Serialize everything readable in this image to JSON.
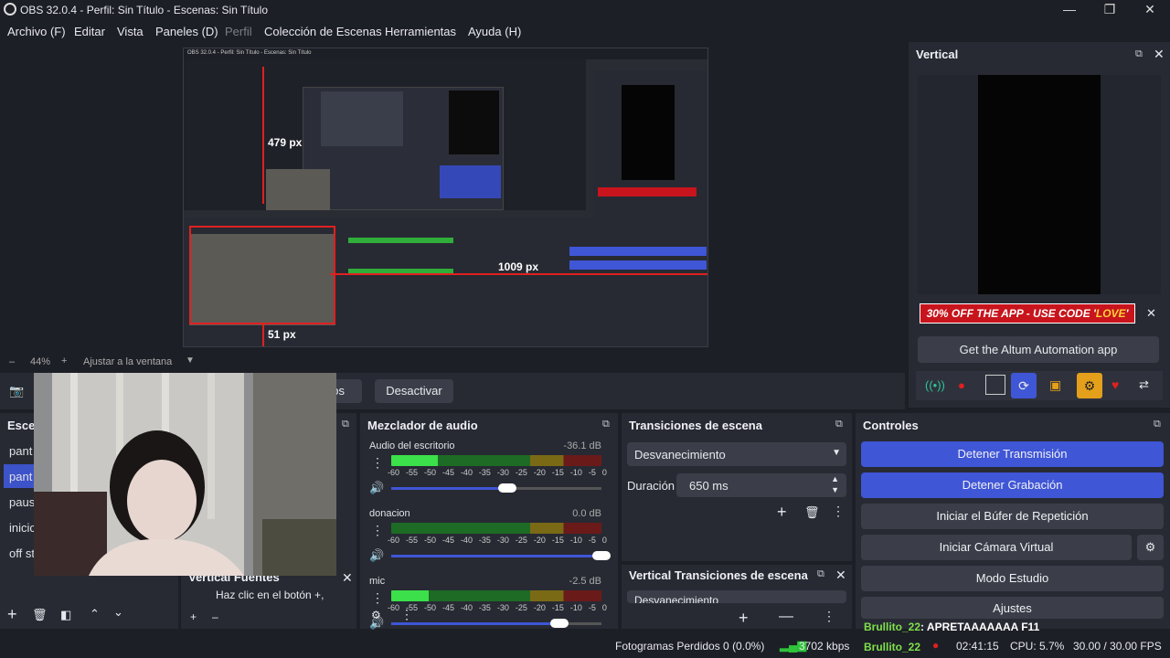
{
  "window": {
    "title": "OBS 32.0.4 - Perfil: Sin Título - Escenas: Sin Título",
    "minimize": "—",
    "maximize": "❐",
    "close": "✕"
  },
  "menu": [
    "Archivo (F)",
    "Editar",
    "Vista",
    "Paneles (D)",
    "Perfil",
    "Colección de Escenas",
    "Herramientas",
    "Ayuda (H)"
  ],
  "preview": {
    "nested_title": "OBS 32.0.4 - Perfil: Sin Título - Escenas: Sin Título",
    "measure_top": "479 px",
    "measure_right": "1009 px",
    "measure_bottom": "51 px"
  },
  "zoom": {
    "minus": "–",
    "value": "44%",
    "plus": "+",
    "fit_label": "Ajustar a la ventana"
  },
  "source_toolbar": {
    "filters_partial": "ros",
    "deactivate_label": "Desactivar"
  },
  "scenes": {
    "title_partial": "Escen",
    "items": [
      {
        "label": "pant",
        "selected": false
      },
      {
        "label": "pant",
        "selected": true
      },
      {
        "label": "paus",
        "selected": false
      },
      {
        "label": "inicic",
        "selected": false
      },
      {
        "label": "off st",
        "selected": false
      }
    ]
  },
  "vertical_sources": {
    "title": "Vertical Fuentes",
    "hint": "Haz clic en el botón +,"
  },
  "audio_mixer": {
    "title": "Mezclador de audio",
    "scale": [
      "-60",
      "-55",
      "-50",
      "-45",
      "-40",
      "-35",
      "-30",
      "-25",
      "-20",
      "-15",
      "-10",
      "-5",
      "0"
    ],
    "channels": [
      {
        "name": "Audio del escritorio",
        "db": "-36.1 dB",
        "level": 0.22,
        "volume": 0.55
      },
      {
        "name": "donacion",
        "db": "0.0 dB",
        "level": 0.0,
        "volume": 1.0
      },
      {
        "name": "mic",
        "db": "-2.5 dB",
        "level": 0.18,
        "volume": 0.8
      }
    ]
  },
  "transitions": {
    "title": "Transiciones de escena",
    "selected": "Desvanecimiento",
    "duration_label": "Duración",
    "duration_value": "650 ms"
  },
  "vertical_transitions": {
    "title": "Vertical Transiciones de escena",
    "selected": "Desvanecimiento"
  },
  "controls": {
    "title": "Controles",
    "buttons": [
      {
        "label": "Detener Transmisión",
        "active": true
      },
      {
        "label": "Detener Grabación",
        "active": true
      },
      {
        "label": "Iniciar el Búfer de Repetición",
        "active": false
      },
      {
        "label": "Iniciar Cámara Virtual",
        "active": false
      },
      {
        "label": "Modo Estudio",
        "active": false
      },
      {
        "label": "Ajustes",
        "active": false
      }
    ]
  },
  "vertical": {
    "title": "Vertical",
    "promo_text_prefix": "30% OFF THE APP - USE CODE '",
    "promo_code": "LOVE",
    "promo_text_suffix": "'",
    "altum_button": "Get the Altum Automation app",
    "accent": "#3f56d6",
    "promo_bg": "#c8141c"
  },
  "chat": [
    {
      "user": "Brullito_22",
      "message": ": APRETAAAAAAA F11"
    },
    {
      "user": "Brullito_22",
      "message": ""
    }
  ],
  "status": {
    "frames_dropped": "Fotogramas Perdidos 0 (0.0%)",
    "bitrate": "3702 kbps",
    "rec_time": "02:41:15",
    "cpu": "CPU: 5.7%",
    "fps": "30.00 / 30.00 FPS"
  }
}
